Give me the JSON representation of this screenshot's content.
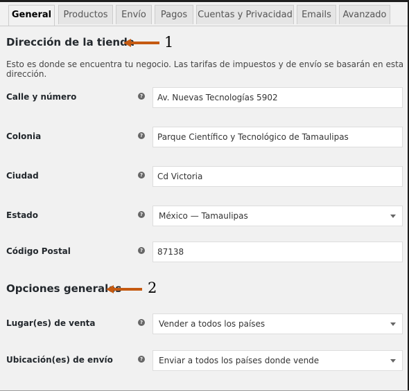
{
  "tabs": [
    {
      "label": "General",
      "active": true
    },
    {
      "label": "Productos"
    },
    {
      "label": "Envío"
    },
    {
      "label": "Pagos"
    },
    {
      "label": "Cuentas y Privacidad"
    },
    {
      "label": "Emails"
    },
    {
      "label": "Avanzado"
    }
  ],
  "store_address": {
    "title": "Dirección de la tienda",
    "marker": "1",
    "description": "Esto es donde se encuentra tu negocio. Las tarifas de impuestos y de envío se basarán en esta dirección.",
    "fields": [
      {
        "label": "Calle y número",
        "value": "Av. Nuevas Tecnologías 5902"
      },
      {
        "label": "Colonia",
        "value": "Parque Científico y Tecnológico de Tamaulipas"
      },
      {
        "label": "Ciudad",
        "value": "Cd Victoria"
      },
      {
        "label": "Estado",
        "value": "México — Tamaulipas"
      },
      {
        "label": "Código Postal",
        "value": "87138"
      }
    ]
  },
  "general_options": {
    "title": "Opciones generales",
    "marker": "2",
    "fields": [
      {
        "label": "Lugar(es) de venta",
        "value": "Vender a todos los países"
      },
      {
        "label": "Ubicación(es) de envío",
        "value": "Enviar a todos los países donde vende"
      }
    ]
  },
  "help_glyph": "?",
  "colors": {
    "arrow": "#c55a11",
    "background": "#f1f1f1",
    "tab_inactive": "#e5e5e5"
  },
  "icons": {
    "help": "question-circle-icon",
    "dropdown": "chevron-down-icon",
    "arrow": "arrow-left-icon"
  }
}
